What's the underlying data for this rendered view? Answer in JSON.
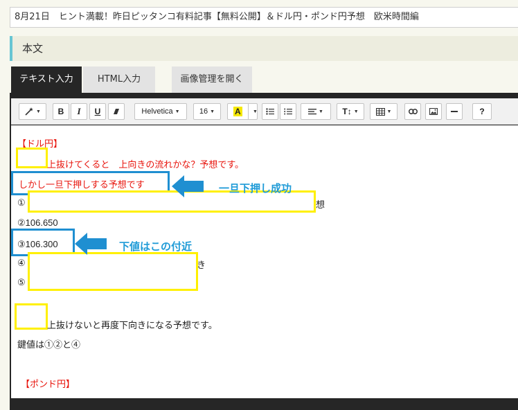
{
  "post_title": "8月21日　ヒント満載！昨日ピッタンコ有料記事【無料公開】＆ドル円・ポンド円予想　欧米時間編",
  "section": {
    "label": "本文"
  },
  "tabs": [
    {
      "label": "テキスト入力",
      "active": true
    },
    {
      "label": "HTML入力",
      "active": false
    },
    {
      "label": "画像管理を開く",
      "active": false
    }
  ],
  "toolbar": {
    "bold": "B",
    "italic": "I",
    "underline": "U",
    "font_family": "Helvetica",
    "font_size": "16",
    "highlight": "A",
    "line_height": "T↕",
    "help": "?",
    "icons": [
      "magic-wand-icon",
      "eraser-icon",
      "unordered-list-icon",
      "ordered-list-icon",
      "align-icon",
      "table-icon",
      "link-icon",
      "image-icon",
      "horizontal-rule-icon"
    ]
  },
  "content": {
    "usd_jpy_heading": "【ドル円】",
    "line_up_break": "上抜けてくると　上向きの流れかな？予想です。",
    "line_push_down": "しかし一旦下押しする予想です",
    "item1_prefix": "①",
    "item1_suffix": "想",
    "item2": "②106.650",
    "item3": "③106.300",
    "item4_prefix": "④",
    "item4_suffix": "き",
    "item5_prefix": "⑤",
    "line_no_break": "上抜けないと再度下向きになる予想です。",
    "key_values": "鍵値は①②と④",
    "gbp_jpy_heading": "【ポンド円】"
  },
  "annotations": {
    "callout1": "一旦下押し成功",
    "callout2": "下値はこの付近"
  },
  "colors": {
    "accent_teal": "#67c5d3",
    "text_red": "#e8140c",
    "highlight_yellow": "#fff000",
    "annotation_blue": "#1f8fd1"
  }
}
